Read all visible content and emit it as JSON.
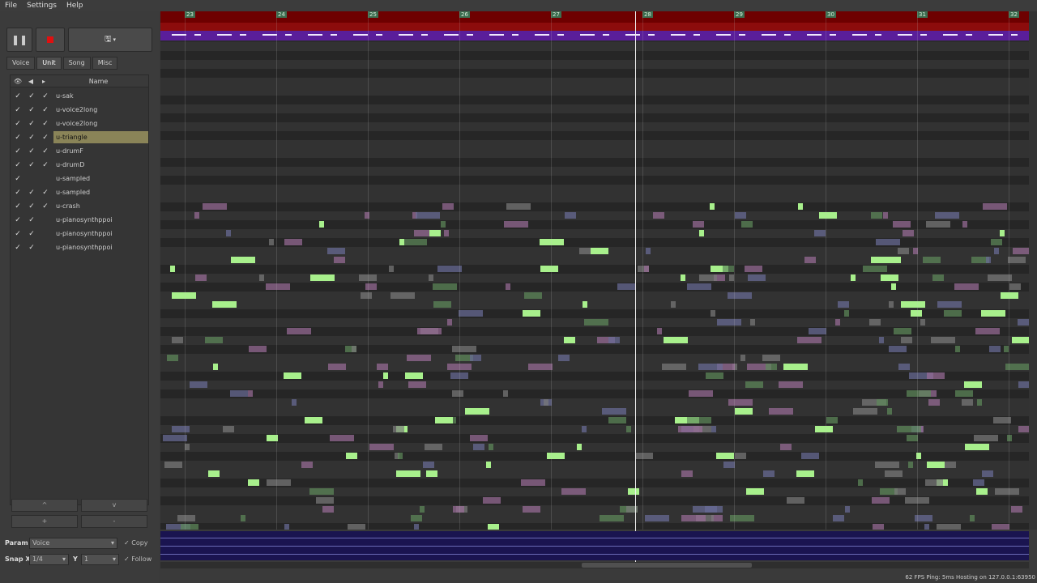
{
  "menu": [
    "File",
    "Settings",
    "Help"
  ],
  "transport": {
    "pause_icon": "pause-icon",
    "stop_icon": "stop-icon",
    "save_icon": "save-icon",
    "save_label": "▾"
  },
  "tabs": [
    {
      "label": "Voice"
    },
    {
      "label": "Unit",
      "active": true
    },
    {
      "label": "Song"
    },
    {
      "label": "Misc"
    }
  ],
  "unit_header": {
    "name": "Name"
  },
  "units": [
    {
      "name": "u-sak",
      "v1": "✓",
      "v2": "✓",
      "v3": "✓"
    },
    {
      "name": "u-voice2long",
      "v1": "✓",
      "v2": "✓",
      "v3": "✓"
    },
    {
      "name": "u-voice2long",
      "v1": "✓",
      "v2": "✓",
      "v3": "✓"
    },
    {
      "name": "u-triangle",
      "v1": "✓",
      "v2": "✓",
      "v3": "✓",
      "active": true
    },
    {
      "name": "u-drumF",
      "v1": "✓",
      "v2": "✓",
      "v3": "✓"
    },
    {
      "name": "u-drumD",
      "v1": "✓",
      "v2": "✓",
      "v3": "✓"
    },
    {
      "name": "u-sampled",
      "v1": "✓",
      "v2": "",
      "v3": ""
    },
    {
      "name": "u-sampled",
      "v1": "✓",
      "v2": "✓",
      "v3": "✓"
    },
    {
      "name": "u-crash",
      "v1": "✓",
      "v2": "✓",
      "v3": "✓"
    },
    {
      "name": "u-pianosynthppoi",
      "v1": "✓",
      "v2": "✓",
      "v3": ""
    },
    {
      "name": "u-pianosynthppoi",
      "v1": "✓",
      "v2": "✓",
      "v3": ""
    },
    {
      "name": "u-pianosynthppoi",
      "v1": "✓",
      "v2": "✓",
      "v3": ""
    }
  ],
  "unit_buttons": {
    "up": "^",
    "down": "v",
    "add": "+",
    "remove": "-"
  },
  "bottom": {
    "param_label": "Param",
    "param_value": "Voice",
    "copy_label": "Copy",
    "copy_check": "✓",
    "snap_x_label": "Snap X",
    "snap_x_value": "1/4",
    "y_label": "Y",
    "y_value": "1",
    "follow_label": "Follow",
    "follow_check": "✓"
  },
  "measures": [
    "23",
    "24",
    "25",
    "26",
    "27",
    "28",
    "29",
    "30",
    "31",
    "32"
  ],
  "status": "62 FPS  Ping: 5ms  Hosting on 127.0.0.1:63950",
  "colors": {
    "bright_green": "#a8f08c",
    "dim_green": "#5e8a5a",
    "pink": "#9a6c98",
    "slate": "#6a6c98",
    "gray": "#7a7a7a",
    "ruler": "#6e0000",
    "purple": "#5a1e9a"
  }
}
